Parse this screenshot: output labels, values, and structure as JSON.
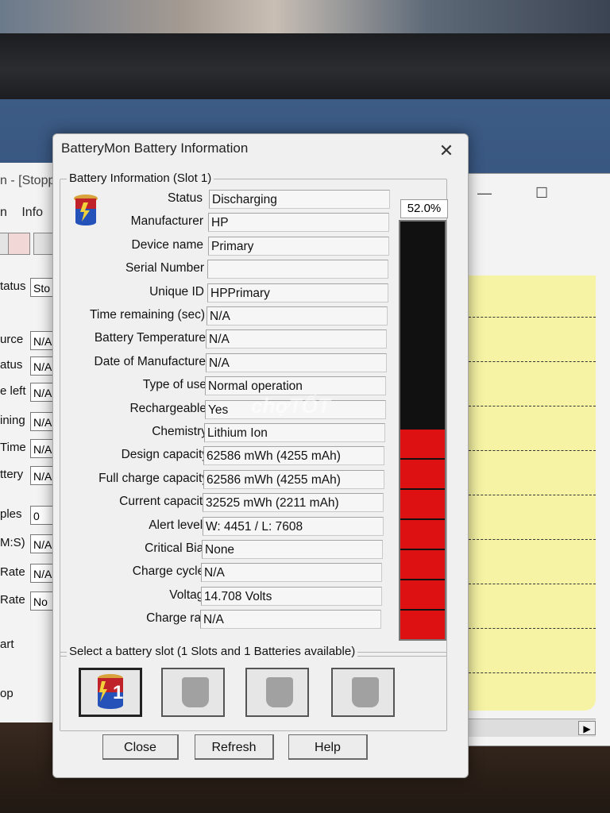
{
  "dialog": {
    "title": "BatteryMon Battery Information",
    "group_title": "Battery Information (Slot 1)",
    "percent": "52.0%",
    "charge_fraction": 0.52,
    "fields": [
      {
        "label": "Status",
        "value": "Discharging"
      },
      {
        "label": "Manufacturer",
        "value": "HP"
      },
      {
        "label": "Device name",
        "value": "Primary"
      },
      {
        "label": "Serial Number",
        "value": ""
      },
      {
        "label": "Unique ID",
        "value": "HPPrimary"
      },
      {
        "label": "Time remaining (sec)",
        "value": "N/A"
      },
      {
        "label": "Battery Temperature",
        "value": "N/A"
      },
      {
        "label": "Date of Manufacture",
        "value": "N/A"
      },
      {
        "label": "Type of use",
        "value": "Normal operation"
      },
      {
        "label": "Rechargeable",
        "value": "Yes"
      },
      {
        "label": "Chemistry",
        "value": "Lithium Ion"
      },
      {
        "label": "Design capacity",
        "value": "62586 mWh (4255 mAh)"
      },
      {
        "label": "Full charge capacity",
        "value": "62586 mWh (4255 mAh)"
      },
      {
        "label": "Current capacity",
        "value": "32525 mWh (2211 mAh)"
      },
      {
        "label": "Alert levels",
        "value": "W: 4451 / L: 7608"
      },
      {
        "label": "Critical Bias",
        "value": "None"
      },
      {
        "label": "Charge cycles",
        "value": "N/A"
      },
      {
        "label": "Voltage",
        "value": "14.708 Volts"
      },
      {
        "label": "Charge rate",
        "value": "N/A"
      }
    ],
    "slot_group_title": "Select a battery slot (1 Slots and 1 Batteries available)",
    "slot_active_number": "1",
    "buttons": {
      "close": "Close",
      "refresh": "Refresh",
      "help": "Help"
    }
  },
  "background_left": {
    "title": "n - [Stopp",
    "menu": [
      "n",
      "Info"
    ],
    "rows": [
      {
        "label": "tatus",
        "value": "Sto"
      },
      {
        "label": "urce",
        "value": "N/A"
      },
      {
        "label": "atus",
        "value": "N/A"
      },
      {
        "label": "e left",
        "value": "N/A"
      },
      {
        "label": "ining",
        "value": "N/A"
      },
      {
        "label": "Time",
        "value": "N/A"
      },
      {
        "label": "ttery",
        "value": "N/A"
      },
      {
        "label": "ples",
        "value": "0"
      },
      {
        "label": "M:S)",
        "value": "N/A"
      },
      {
        "label": "Rate",
        "value": "N/A"
      },
      {
        "label": "Rate",
        "value": "No"
      }
    ],
    "bottom_labels": [
      "art",
      "op"
    ]
  },
  "watermark": "chợTỐT",
  "colors": {
    "gauge_fill": "#dd1111",
    "gauge_empty": "#111111",
    "dialog_bg": "#f0f0f0",
    "chart_area": "#f6f3a4"
  }
}
